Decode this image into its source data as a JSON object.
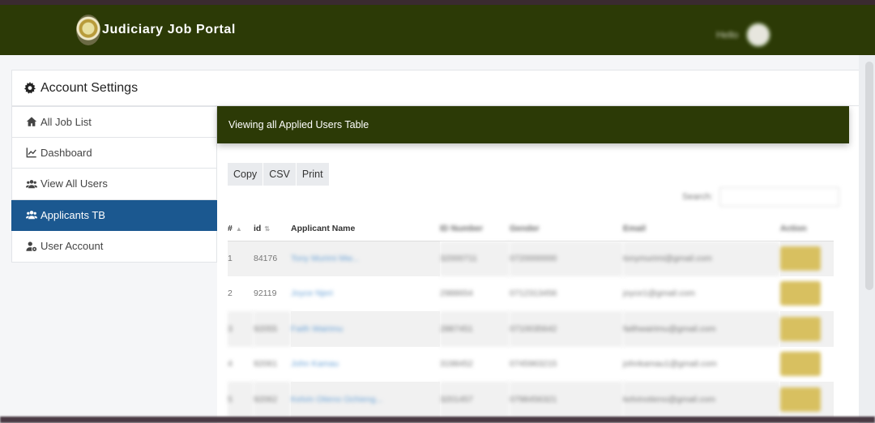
{
  "header": {
    "title": "Judiciary Job Portal",
    "user_name": "Hello"
  },
  "settings": {
    "title": "Account Settings"
  },
  "sidebar": {
    "items": [
      {
        "label": "All Job List",
        "icon": "home-icon"
      },
      {
        "label": "Dashboard",
        "icon": "chart-line-icon"
      },
      {
        "label": "View All Users",
        "icon": "users-icon"
      },
      {
        "label": "Applicants TB",
        "icon": "users-icon",
        "active": true
      },
      {
        "label": "User Account",
        "icon": "user-cog-icon"
      }
    ]
  },
  "card": {
    "title": "Viewing all Applied Users Table"
  },
  "buttons": {
    "copy": "Copy",
    "csv": "CSV",
    "print": "Print"
  },
  "search": {
    "label": "Search:"
  },
  "table": {
    "headers": [
      "#",
      "id",
      "Applicant Name",
      "ID Number",
      "Gender",
      "Email",
      "Action"
    ],
    "rows": [
      {
        "num": "1",
        "id": "84176",
        "name": "Tony Murimi Mw...",
        "idnum": "32000711",
        "gender": "0720000000",
        "email": "tonymurimi@gmail.com"
      },
      {
        "num": "2",
        "id": "92119",
        "name": "Joyce Njeri",
        "idnum": "2988654",
        "gender": "0712313456",
        "email": "joyce1@gmail.com"
      },
      {
        "num": "3",
        "id": "92055",
        "name": "Faith Wairimu",
        "idnum": "2887451",
        "gender": "0710035642",
        "email": "faithwairimu@gmail.com"
      },
      {
        "num": "4",
        "id": "92061",
        "name": "John Kamau",
        "idnum": "3198452",
        "gender": "0745963215",
        "email": "johnkamau1@gmail.com"
      },
      {
        "num": "5",
        "id": "92062",
        "name": "Kelvin Otieno Ochieng...",
        "idnum": "3201457",
        "gender": "0798456321",
        "email": "kelvinotieno@gmail.com"
      }
    ]
  },
  "colors": {
    "brand": "#2c3a06",
    "active": "#1b5890",
    "action": "#d8c060"
  }
}
